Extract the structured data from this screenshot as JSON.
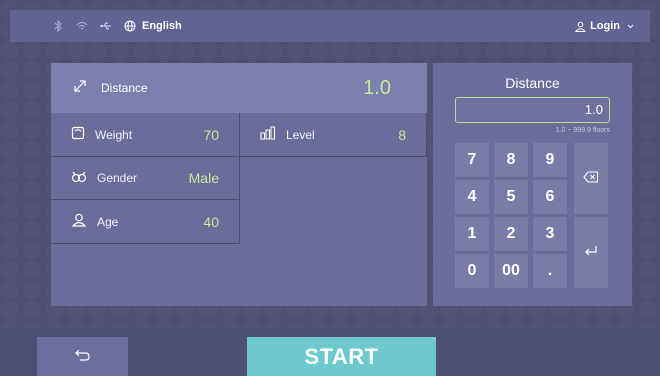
{
  "topbar": {
    "icons": [
      "bluetooth-icon",
      "wifi-icon",
      "usb-icon",
      "globe-icon"
    ],
    "language_label": "English",
    "login_label": "Login"
  },
  "fields": {
    "distance": {
      "label": "Distance",
      "value": "1.0",
      "icon": "diagonal-arrow-icon"
    },
    "weight": {
      "label": "Weight",
      "value": "70",
      "icon": "scale-icon"
    },
    "level": {
      "label": "Level",
      "value": "8",
      "icon": "bars-icon"
    },
    "gender": {
      "label": "Gender",
      "value": "Male",
      "icon": "gender-icon"
    },
    "age": {
      "label": "Age",
      "value": "40",
      "icon": "person-icon"
    }
  },
  "keypad": {
    "title": "Distance",
    "input_value": "1.0",
    "range_hint": "1.0 ~ 999.9 floors",
    "keys": [
      "7",
      "8",
      "9",
      "4",
      "5",
      "6",
      "1",
      "2",
      "3",
      "0",
      "00",
      "."
    ]
  },
  "bottom": {
    "start_label": "START"
  },
  "colors": {
    "accent_value": "#c8e89a",
    "start_button": "#6ec9cf",
    "panel": "#6b6c99",
    "highlight_row": "#7d7fad"
  }
}
